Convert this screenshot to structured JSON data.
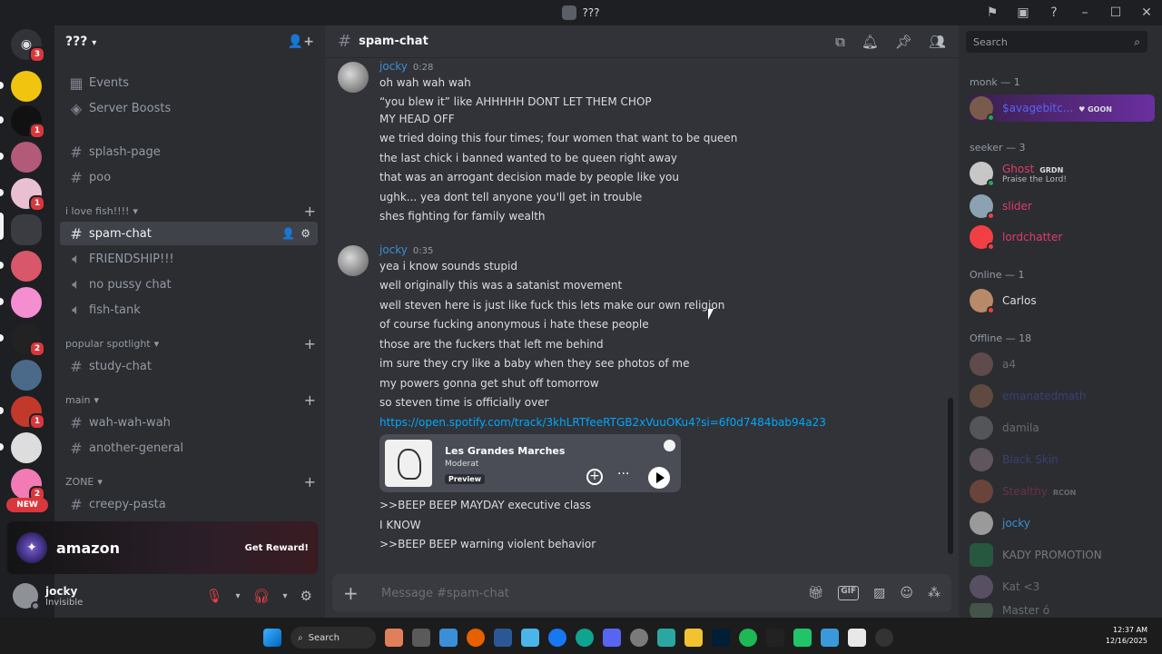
{
  "window": {
    "title": "???"
  },
  "rail": {
    "servers": [
      {
        "name": "home",
        "badge": "3"
      },
      {
        "name": "yellow-server",
        "badge": ""
      },
      {
        "name": "p-server",
        "badge": "1"
      },
      {
        "name": "onair-server",
        "badge": ""
      },
      {
        "name": "pink-server",
        "badge": "1"
      },
      {
        "name": "dark-server",
        "badge": ""
      },
      {
        "name": "red-hair-server",
        "badge": ""
      },
      {
        "name": "pink-logo-server",
        "badge": ""
      },
      {
        "name": "car-server",
        "badge": "2"
      },
      {
        "name": "figure-server",
        "badge": ""
      },
      {
        "name": "santa-server",
        "badge": "1"
      },
      {
        "name": "anime-server",
        "badge": ""
      },
      {
        "name": "pink2-server",
        "badge": "2"
      }
    ],
    "new_label": "NEW"
  },
  "guild": {
    "name": "???"
  },
  "sidebar": {
    "top_items": [
      {
        "icon": "calendar-icon",
        "label": "Events"
      },
      {
        "icon": "boost-icon",
        "label": "Server Boosts"
      }
    ],
    "channels_top": [
      {
        "type": "text",
        "label": "splash-page"
      },
      {
        "type": "text",
        "label": "poo"
      }
    ],
    "categories": [
      {
        "label": "i love fish!!!!",
        "channels": [
          {
            "type": "text",
            "label": "spam-chat",
            "active": true
          },
          {
            "type": "voice",
            "label": "FRIENDSHIP!!!"
          },
          {
            "type": "voice",
            "label": "no pussy chat"
          },
          {
            "type": "voice",
            "label": "fish-tank"
          }
        ]
      },
      {
        "label": "popular spotlight",
        "channels": [
          {
            "type": "text",
            "label": "study-chat"
          }
        ]
      },
      {
        "label": "main",
        "channels": [
          {
            "type": "text",
            "label": "wah-wah-wah"
          },
          {
            "type": "text",
            "label": "another-general"
          }
        ]
      },
      {
        "label": "ZONE",
        "channels": [
          {
            "type": "text",
            "label": "creepy-pasta"
          }
        ]
      }
    ]
  },
  "promo": {
    "brand": "amazon",
    "cta": "Get Reward!"
  },
  "user": {
    "name": "jocky",
    "status": "Invisible"
  },
  "chat": {
    "channel": "spam-chat",
    "groups": [
      {
        "author": "jocky",
        "time": "0:28",
        "lines": [
          "oh wah wah wah",
          "“you blew it” like AHHHHH DONT LET THEM CHOP",
          "MY HEAD OFF",
          "we tried doing this four times; four women that want to be queen",
          "the last chick i banned wanted to be queen right away",
          "that was an arrogant decision made by people like you",
          "ughk... yea dont tell anyone you'll get in trouble",
          "shes fighting for family wealth"
        ]
      },
      {
        "author": "jocky",
        "time": "0:35",
        "lines": [
          "yea i know sounds stupid",
          "well originally this was a satanist movement",
          "well steven here is just like fuck this lets make our own religion",
          "of course fucking anonymous i hate these people",
          "those are the fuckers that left me behind",
          "im sure they cry like a baby when they see photos of me",
          "my powers gonna get shut off tomorrow",
          "so steven time is officially over"
        ],
        "link": "https://open.spotify.com/track/3khLRTfeeRTGB2xVuuOKu4?si=6f0d7484bab94a23",
        "embed": {
          "title": "Les Grandes Marches",
          "artist": "Moderat",
          "badge": "Preview"
        },
        "after_lines": [
          ">>BEEP BEEP MAYDAY executive class",
          "I KNOW",
          ">>BEEP BEEP warning violent behavior"
        ]
      }
    ],
    "composer_placeholder": "Message #spam-chat"
  },
  "members": {
    "search_placeholder": "Search",
    "sections": [
      {
        "label": "monk — 1",
        "items": [
          {
            "name": "$avagebitc...",
            "tag": "♥ GOON",
            "status": "online",
            "highlight": true
          }
        ]
      },
      {
        "label": "seeker — 3",
        "items": [
          {
            "name": "Ghost",
            "tag": "GRDN",
            "sub": "Praise the Lord!",
            "status": "mobile"
          },
          {
            "name": "slider",
            "status": "dnd"
          },
          {
            "name": "lordchatter",
            "status": "dnd"
          }
        ]
      },
      {
        "label": "Online — 1",
        "items": [
          {
            "name": "Carlos",
            "status": "dnd"
          }
        ]
      },
      {
        "label": "Offline — 18",
        "items": [
          {
            "name": "a4"
          },
          {
            "name": "emanatedmath"
          },
          {
            "name": "damila"
          },
          {
            "name": "Black Skin"
          },
          {
            "name": "Stealthy",
            "tag": "RCON"
          },
          {
            "name": "jocky",
            "bright": true
          },
          {
            "name": "KADY PROMOTION"
          },
          {
            "name": "Kat <3"
          },
          {
            "name": "Master ó"
          }
        ]
      }
    ]
  },
  "taskbar": {
    "search_label": "Search",
    "time": "12:37 AM",
    "date": "12/16/2025"
  },
  "colors": {
    "accent": "#5865f2",
    "link": "#00a8fc",
    "author": "#3b8fd1",
    "dnd": "#f23f43",
    "online": "#23a55a"
  }
}
